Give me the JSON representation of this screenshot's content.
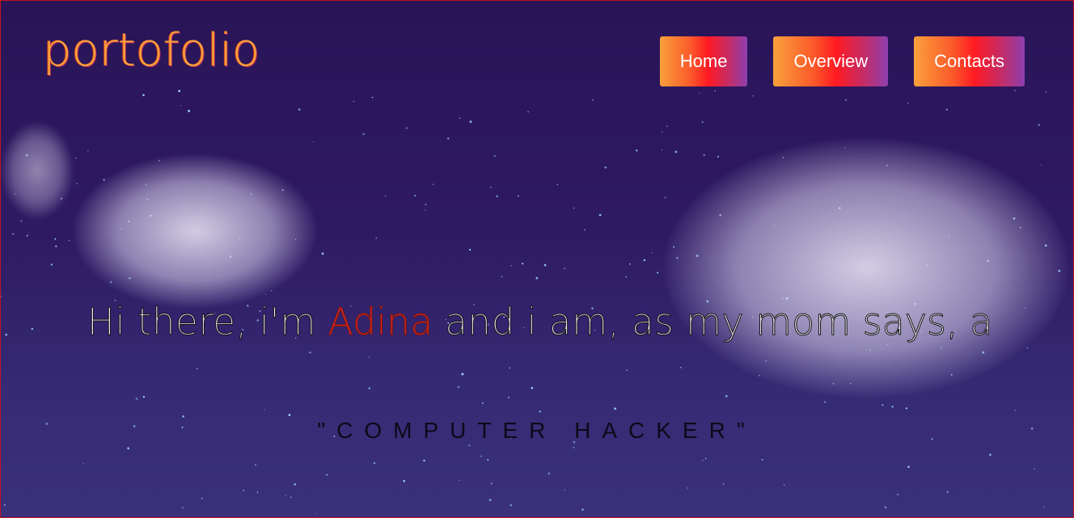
{
  "brand": {
    "logo_text": "portofolio"
  },
  "nav": {
    "items": [
      {
        "label": "Home"
      },
      {
        "label": "Overview"
      },
      {
        "label": "Contacts"
      }
    ]
  },
  "hero": {
    "intro_before": "Hi there, i'm ",
    "name": "Adina",
    "intro_after": " and i am, as my mom says, a",
    "subtitle": "\"COMPUTER HACKER\""
  },
  "colors": {
    "background_top": "#2a1457",
    "background_bottom": "#3b307a",
    "logo": "#f8a23a",
    "name_accent": "#e12a1e",
    "button_gradient_start": "#f9a13c",
    "button_gradient_mid": "#ff1a22",
    "button_gradient_end": "#8d3fb0",
    "frame_border": "#c2121e"
  }
}
